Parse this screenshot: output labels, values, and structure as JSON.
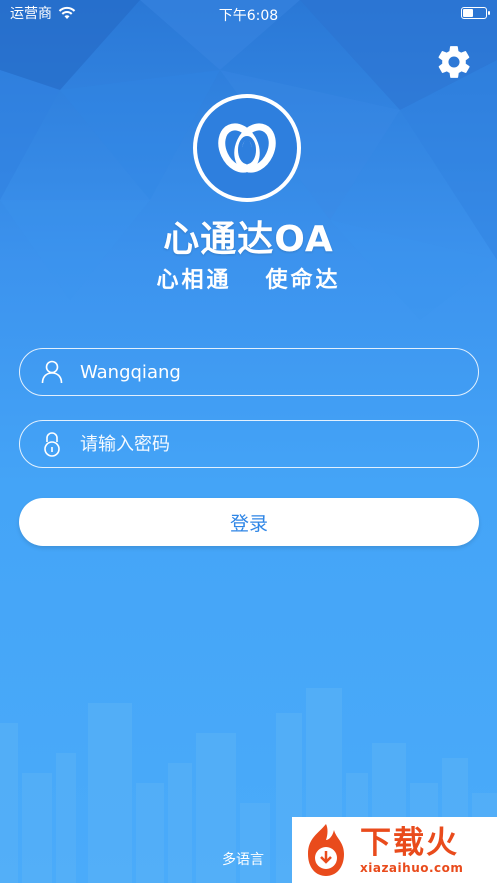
{
  "status_bar": {
    "carrier": "运营商",
    "time": "下午6:08"
  },
  "app": {
    "title": "心通达OA",
    "slogan_left": "心相通",
    "slogan_right": "使命达"
  },
  "login_form": {
    "username_value": "Wangqiang",
    "password_placeholder": "请输入密码",
    "login_label": "登录"
  },
  "footer": {
    "language_label": "多语言"
  },
  "watermark": {
    "title": "下载火",
    "url": "xiazaihuo.com"
  },
  "icons": {
    "settings": "gear-icon",
    "user": "user-icon",
    "lock": "lock-icon",
    "wifi": "wifi-icon",
    "battery": "battery-icon"
  },
  "colors": {
    "background_top": "#2a78d6",
    "background_bottom": "#4aabfa",
    "button_text": "#2f86e6",
    "watermark": "#e94b1c"
  }
}
